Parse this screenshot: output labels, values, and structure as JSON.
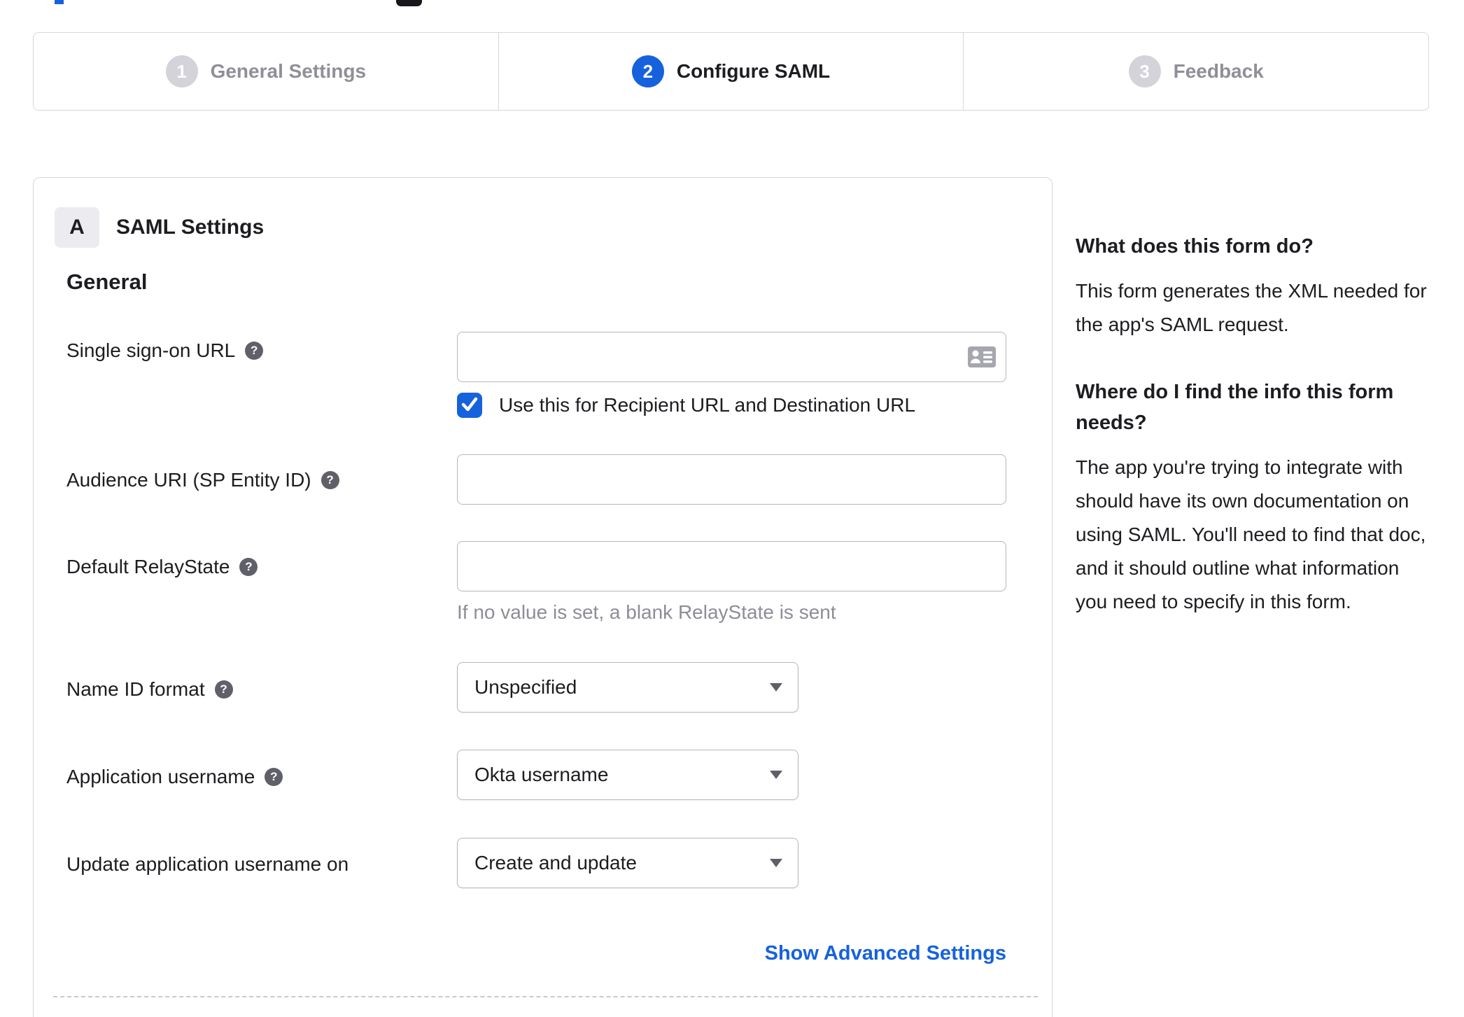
{
  "icons": {
    "help_glyph": "?"
  },
  "colors": {
    "accent_blue": "#1662dd",
    "inactive_step_gray": "#d3d3d9",
    "panel_border": "#d7d7dc",
    "hint_gray": "#8d8d99"
  },
  "stepper": {
    "steps": [
      {
        "number": "1",
        "label": "General Settings",
        "state": "inactive"
      },
      {
        "number": "2",
        "label": "Configure SAML",
        "state": "active"
      },
      {
        "number": "3",
        "label": "Feedback",
        "state": "inactive"
      }
    ]
  },
  "saml_panel": {
    "badge": "A",
    "title": "SAML Settings",
    "section_heading": "General",
    "form": {
      "single_sign_on_url": {
        "label": "Single sign-on URL",
        "value": "",
        "checkbox_label": "Use this for Recipient URL and Destination URL",
        "checkbox_checked": true
      },
      "audience_uri": {
        "label": "Audience URI (SP Entity ID)",
        "value": ""
      },
      "default_relay_state": {
        "label": "Default RelayState",
        "value": "",
        "hint": "If no value is set, a blank RelayState is sent"
      },
      "name_id_format": {
        "label": "Name ID format",
        "value": "Unspecified"
      },
      "application_username": {
        "label": "Application username",
        "value": "Okta username"
      },
      "update_application_username_on": {
        "label": "Update application username on",
        "value": "Create and update"
      }
    },
    "advanced_link": "Show Advanced Settings"
  },
  "sidebar": {
    "sections": [
      {
        "heading": "What does this form do?",
        "body": "This form generates the XML needed for the app's SAML request."
      },
      {
        "heading": "Where do I find the info this form needs?",
        "body": "The app you're trying to integrate with should have its own documentation on using SAML. You'll need to find that doc, and it should outline what information you need to specify in this form."
      }
    ]
  }
}
